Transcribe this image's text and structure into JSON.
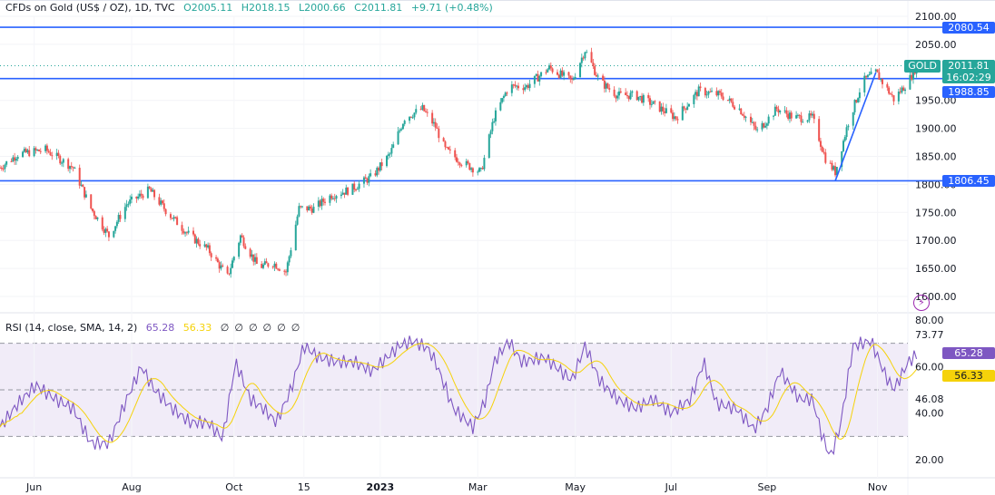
{
  "header": {
    "title": "CFDs on Gold (US$ / OZ), 1D, TVC",
    "open": "O2005.11",
    "high": "H2018.15",
    "low": "L2000.66",
    "close": "C2011.81",
    "change": "+9.71 (+0.48%)"
  },
  "rsi_legend": {
    "label": "RSI (14, close, SMA, 14, 2)",
    "rsi": "65.28",
    "sma": "56.33",
    "empty": [
      "∅",
      "∅",
      "∅",
      "∅",
      "∅",
      "∅"
    ]
  },
  "tags": {
    "symbol": "GOLD",
    "price": "2011.81",
    "countdown": "16:02:29",
    "r1": "2080.54",
    "r2": "1988.85",
    "s1": "1806.45",
    "rsi": "65.28",
    "sma": "56.33",
    "rsi_extra": [
      "73.77",
      "46.08"
    ]
  },
  "colors": {
    "up": "#26a69a",
    "down": "#ef5350",
    "level": "#2962ff",
    "rsi": "#7e57c2",
    "sma": "#f5d20a",
    "band": "#ede7f6"
  },
  "chart_data": [
    {
      "type": "candlestick",
      "title": "CFDs on Gold (US$ / OZ), 1D, TVC",
      "ylim": [
        1580,
        2115
      ],
      "yticks": [
        "2100.00",
        "2050.00",
        "1950.00",
        "1900.00",
        "1850.00",
        "1800.00",
        "1750.00",
        "1700.00",
        "1650.00",
        "1600.00"
      ],
      "ytick_values": [
        2100,
        2050,
        1950,
        1900,
        1850,
        1800,
        1750,
        1700,
        1650,
        1600
      ],
      "xticks": [
        {
          "label": "Jun",
          "day": 21
        },
        {
          "label": "Aug",
          "day": 81
        },
        {
          "label": "Oct",
          "day": 144
        },
        {
          "label": "15",
          "day": 187
        },
        {
          "label": "2023",
          "day": 234
        },
        {
          "label": "Mar",
          "day": 294
        },
        {
          "label": "May",
          "day": 354
        },
        {
          "label": "Jul",
          "day": 413
        },
        {
          "label": "Sep",
          "day": 472
        },
        {
          "label": "Nov",
          "day": 540
        }
      ],
      "close_path": [
        [
          0,
          1830
        ],
        [
          11,
          1854
        ],
        [
          28,
          1862
        ],
        [
          45,
          1830
        ],
        [
          56,
          1757
        ],
        [
          67,
          1708
        ],
        [
          78,
          1765
        ],
        [
          92,
          1790
        ],
        [
          103,
          1750
        ],
        [
          117,
          1708
        ],
        [
          128,
          1684
        ],
        [
          140,
          1635
        ],
        [
          148,
          1708
        ],
        [
          159,
          1652
        ],
        [
          168,
          1660
        ],
        [
          176,
          1644
        ],
        [
          184,
          1757
        ],
        [
          193,
          1757
        ],
        [
          204,
          1781
        ],
        [
          215,
          1790
        ],
        [
          229,
          1814
        ],
        [
          240,
          1854
        ],
        [
          249,
          1919
        ],
        [
          260,
          1935
        ],
        [
          268,
          1903
        ],
        [
          274,
          1862
        ],
        [
          285,
          1838
        ],
        [
          296,
          1822
        ],
        [
          304,
          1919
        ],
        [
          313,
          1975
        ],
        [
          324,
          1975
        ],
        [
          338,
          2008
        ],
        [
          352,
          1984
        ],
        [
          360,
          2040
        ],
        [
          369,
          1984
        ],
        [
          380,
          1959
        ],
        [
          391,
          1959
        ],
        [
          402,
          1943
        ],
        [
          416,
          1919
        ],
        [
          430,
          1967
        ],
        [
          444,
          1959
        ],
        [
          455,
          1935
        ],
        [
          466,
          1895
        ],
        [
          478,
          1935
        ],
        [
          489,
          1919
        ],
        [
          500,
          1919
        ],
        [
          508,
          1846
        ],
        [
          514,
          1822
        ],
        [
          522,
          1911
        ],
        [
          531,
          1984
        ],
        [
          539,
          2000
        ],
        [
          550,
          1952
        ],
        [
          559,
          1984
        ],
        [
          564,
          2011
        ]
      ],
      "levels": [
        2080.54,
        1988.85,
        1806.45
      ],
      "trendline": [
        [
          514,
          1806.45
        ],
        [
          539,
          2000
        ]
      ]
    },
    {
      "type": "line",
      "title": "RSI (14, close, SMA, 14, 2)",
      "ylim": [
        14,
        83
      ],
      "yticks": [
        "80.00",
        "60.00",
        "40.00",
        "20.00"
      ],
      "ytick_values": [
        80,
        60,
        40,
        20
      ],
      "bands": [
        30,
        50,
        70
      ],
      "rsi_path": [
        [
          0,
          34
        ],
        [
          11,
          44
        ],
        [
          22,
          52
        ],
        [
          34,
          46
        ],
        [
          45,
          42
        ],
        [
          56,
          27
        ],
        [
          67,
          27
        ],
        [
          78,
          46
        ],
        [
          87,
          60
        ],
        [
          95,
          50
        ],
        [
          106,
          42
        ],
        [
          117,
          36
        ],
        [
          128,
          36
        ],
        [
          137,
          29
        ],
        [
          145,
          62
        ],
        [
          154,
          46
        ],
        [
          162,
          42
        ],
        [
          170,
          36
        ],
        [
          179,
          50
        ],
        [
          187,
          69
        ],
        [
          196,
          64
        ],
        [
          207,
          62
        ],
        [
          218,
          62
        ],
        [
          229,
          58
        ],
        [
          246,
          69
        ],
        [
          254,
          71
        ],
        [
          263,
          68
        ],
        [
          268,
          62
        ],
        [
          279,
          42
        ],
        [
          291,
          34
        ],
        [
          299,
          46
        ],
        [
          304,
          62
        ],
        [
          313,
          71
        ],
        [
          321,
          62
        ],
        [
          335,
          64
        ],
        [
          352,
          54
        ],
        [
          360,
          69
        ],
        [
          369,
          54
        ],
        [
          380,
          46
        ],
        [
          391,
          42
        ],
        [
          402,
          46
        ],
        [
          413,
          40
        ],
        [
          425,
          46
        ],
        [
          433,
          62
        ],
        [
          441,
          44
        ],
        [
          453,
          42
        ],
        [
          464,
          33
        ],
        [
          472,
          42
        ],
        [
          480,
          58
        ],
        [
          492,
          46
        ],
        [
          500,
          46
        ],
        [
          506,
          30
        ],
        [
          511,
          21
        ],
        [
          517,
          34
        ],
        [
          525,
          69
        ],
        [
          536,
          71
        ],
        [
          545,
          56
        ],
        [
          550,
          50
        ],
        [
          559,
          62
        ],
        [
          564,
          65
        ]
      ]
    }
  ]
}
